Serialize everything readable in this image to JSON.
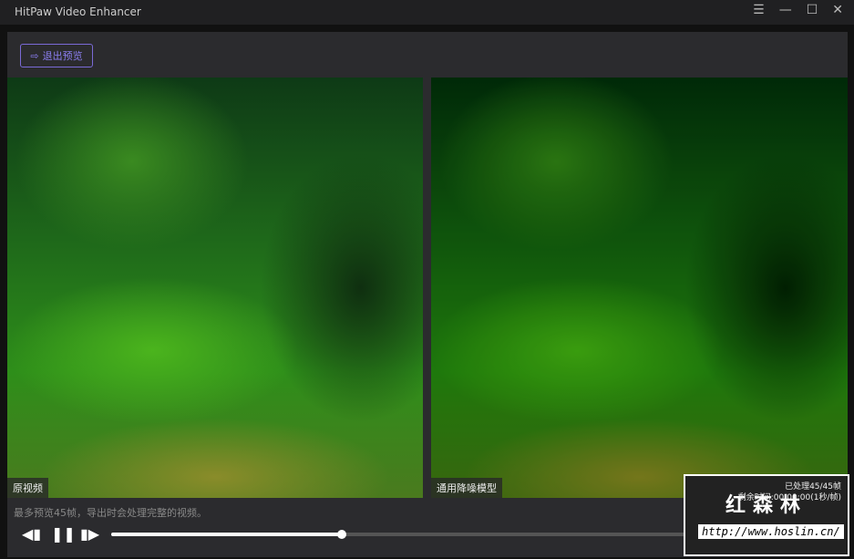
{
  "app": {
    "title": "HitPaw Video Enhancer",
    "window_buttons": [
      "☰",
      "—",
      "☐",
      "✕"
    ]
  },
  "toolbar": {
    "exit_preview": "退出预览"
  },
  "left_pane": {
    "label": "原视频"
  },
  "right_pane": {
    "label": "通用降噪模型",
    "processed": "已处理45/45帧",
    "remaining": "剩余时间:00:00:00(1秒/帧)"
  },
  "hint": "最多预览45帧，导出时会处理完整的视频。",
  "player": {
    "prev": "◀▮",
    "pause": "❚❚",
    "next": "▮▶",
    "progress_fraction": 0.32
  },
  "watermark": {
    "title": "红森林",
    "url": "http://www.hoslin.cn/"
  }
}
